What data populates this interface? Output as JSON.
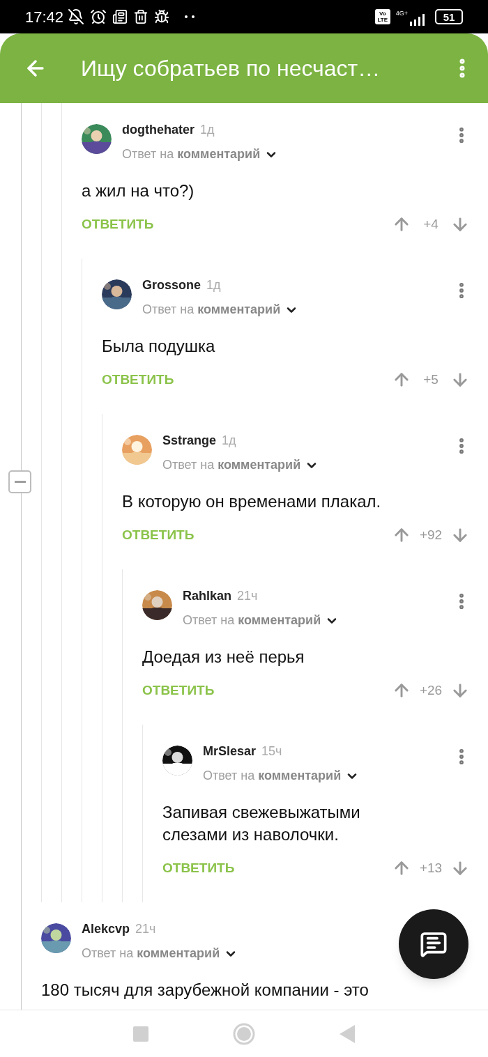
{
  "status_bar": {
    "time": "17:42",
    "volte": "Vo LTE",
    "network": "4G+",
    "battery": "51"
  },
  "header": {
    "title": "Ищу собратьев по несчаст…"
  },
  "comments": [
    {
      "author": "dogthehater",
      "time": "1д",
      "reply_to": "Ответ на **комментарий**",
      "text": "а жил на что?)",
      "reply_button": "ОТВЕТИТЬ",
      "score": "+4",
      "children": [
        {
          "author": "Grossone",
          "time": "1д",
          "reply_to": "Ответ на **комментарий**",
          "text": "Была подушка",
          "reply_button": "ОТВЕТИТЬ",
          "score": "+5",
          "children": [
            {
              "author": "Sstrange",
              "time": "1д",
              "reply_to": "Ответ на **комментарий**",
              "text": "В которую он временами плакал.",
              "reply_button": "ОТВЕТИТЬ",
              "score": "+92",
              "children": [
                {
                  "author": "Rahlkan",
                  "time": "21ч",
                  "reply_to": "Ответ на **комментарий**",
                  "text": "Доедая из неё перья",
                  "reply_button": "ОТВЕТИТЬ",
                  "score": "+26",
                  "children": [
                    {
                      "author": "MrSlesar",
                      "time": "15ч",
                      "reply_to": "Ответ на **комментарий**",
                      "text": "Запивая свежевыжатыми слезами из наволочки.",
                      "reply_button": "ОТВЕТИТЬ",
                      "score": "+13"
                    }
                  ]
                }
              ]
            }
          ]
        }
      ]
    },
    {
      "author": "Alekcvp",
      "time": "21ч",
      "reply_to": "Ответ на **комментарий**",
      "text": "180 тысяч для зарубежной компании - это"
    }
  ]
}
